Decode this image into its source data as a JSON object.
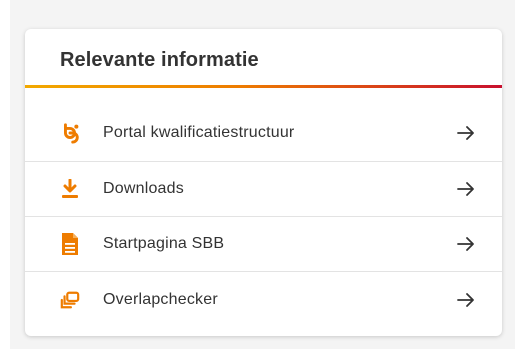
{
  "card": {
    "title": "Relevante informatie"
  },
  "links": [
    {
      "label": "Portal kwalificatiestructuur",
      "icon": "portal-logo-icon"
    },
    {
      "label": "Downloads",
      "icon": "download-icon"
    },
    {
      "label": "Startpagina SBB",
      "icon": "document-icon"
    },
    {
      "label": "Overlapchecker",
      "icon": "overlap-icon"
    }
  ],
  "colors": {
    "icon_orange": "#ee7c00",
    "gradient_start": "#f2a900",
    "gradient_end": "#c8102e",
    "text": "#333333"
  }
}
